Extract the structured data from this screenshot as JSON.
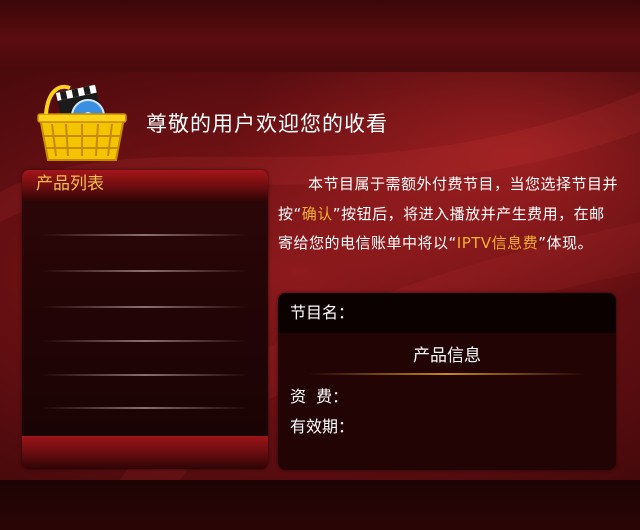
{
  "header": {
    "title": "尊敬的用户欢迎您的收看",
    "icon": "shopping-basket-icon"
  },
  "product_list": {
    "title": "产品列表",
    "items": []
  },
  "notice": {
    "part1": "本节目属于需额外付费节目，当您选择节目并按“",
    "confirm": "确认",
    "part2": "”按钮后，将进入播放并产生费用，在邮寄给您的电信账单中将以“",
    "fee_label": "IPTV信息费",
    "part3": "”体现。"
  },
  "info": {
    "program_name_label": "节目名：",
    "title": "产品信息",
    "fee_label": "资  费：",
    "validity_label": "有效期："
  },
  "colors": {
    "accent_gold": "#f3b22e",
    "panel_title": "#f3c04a",
    "background_red": "#8e1a1d"
  }
}
